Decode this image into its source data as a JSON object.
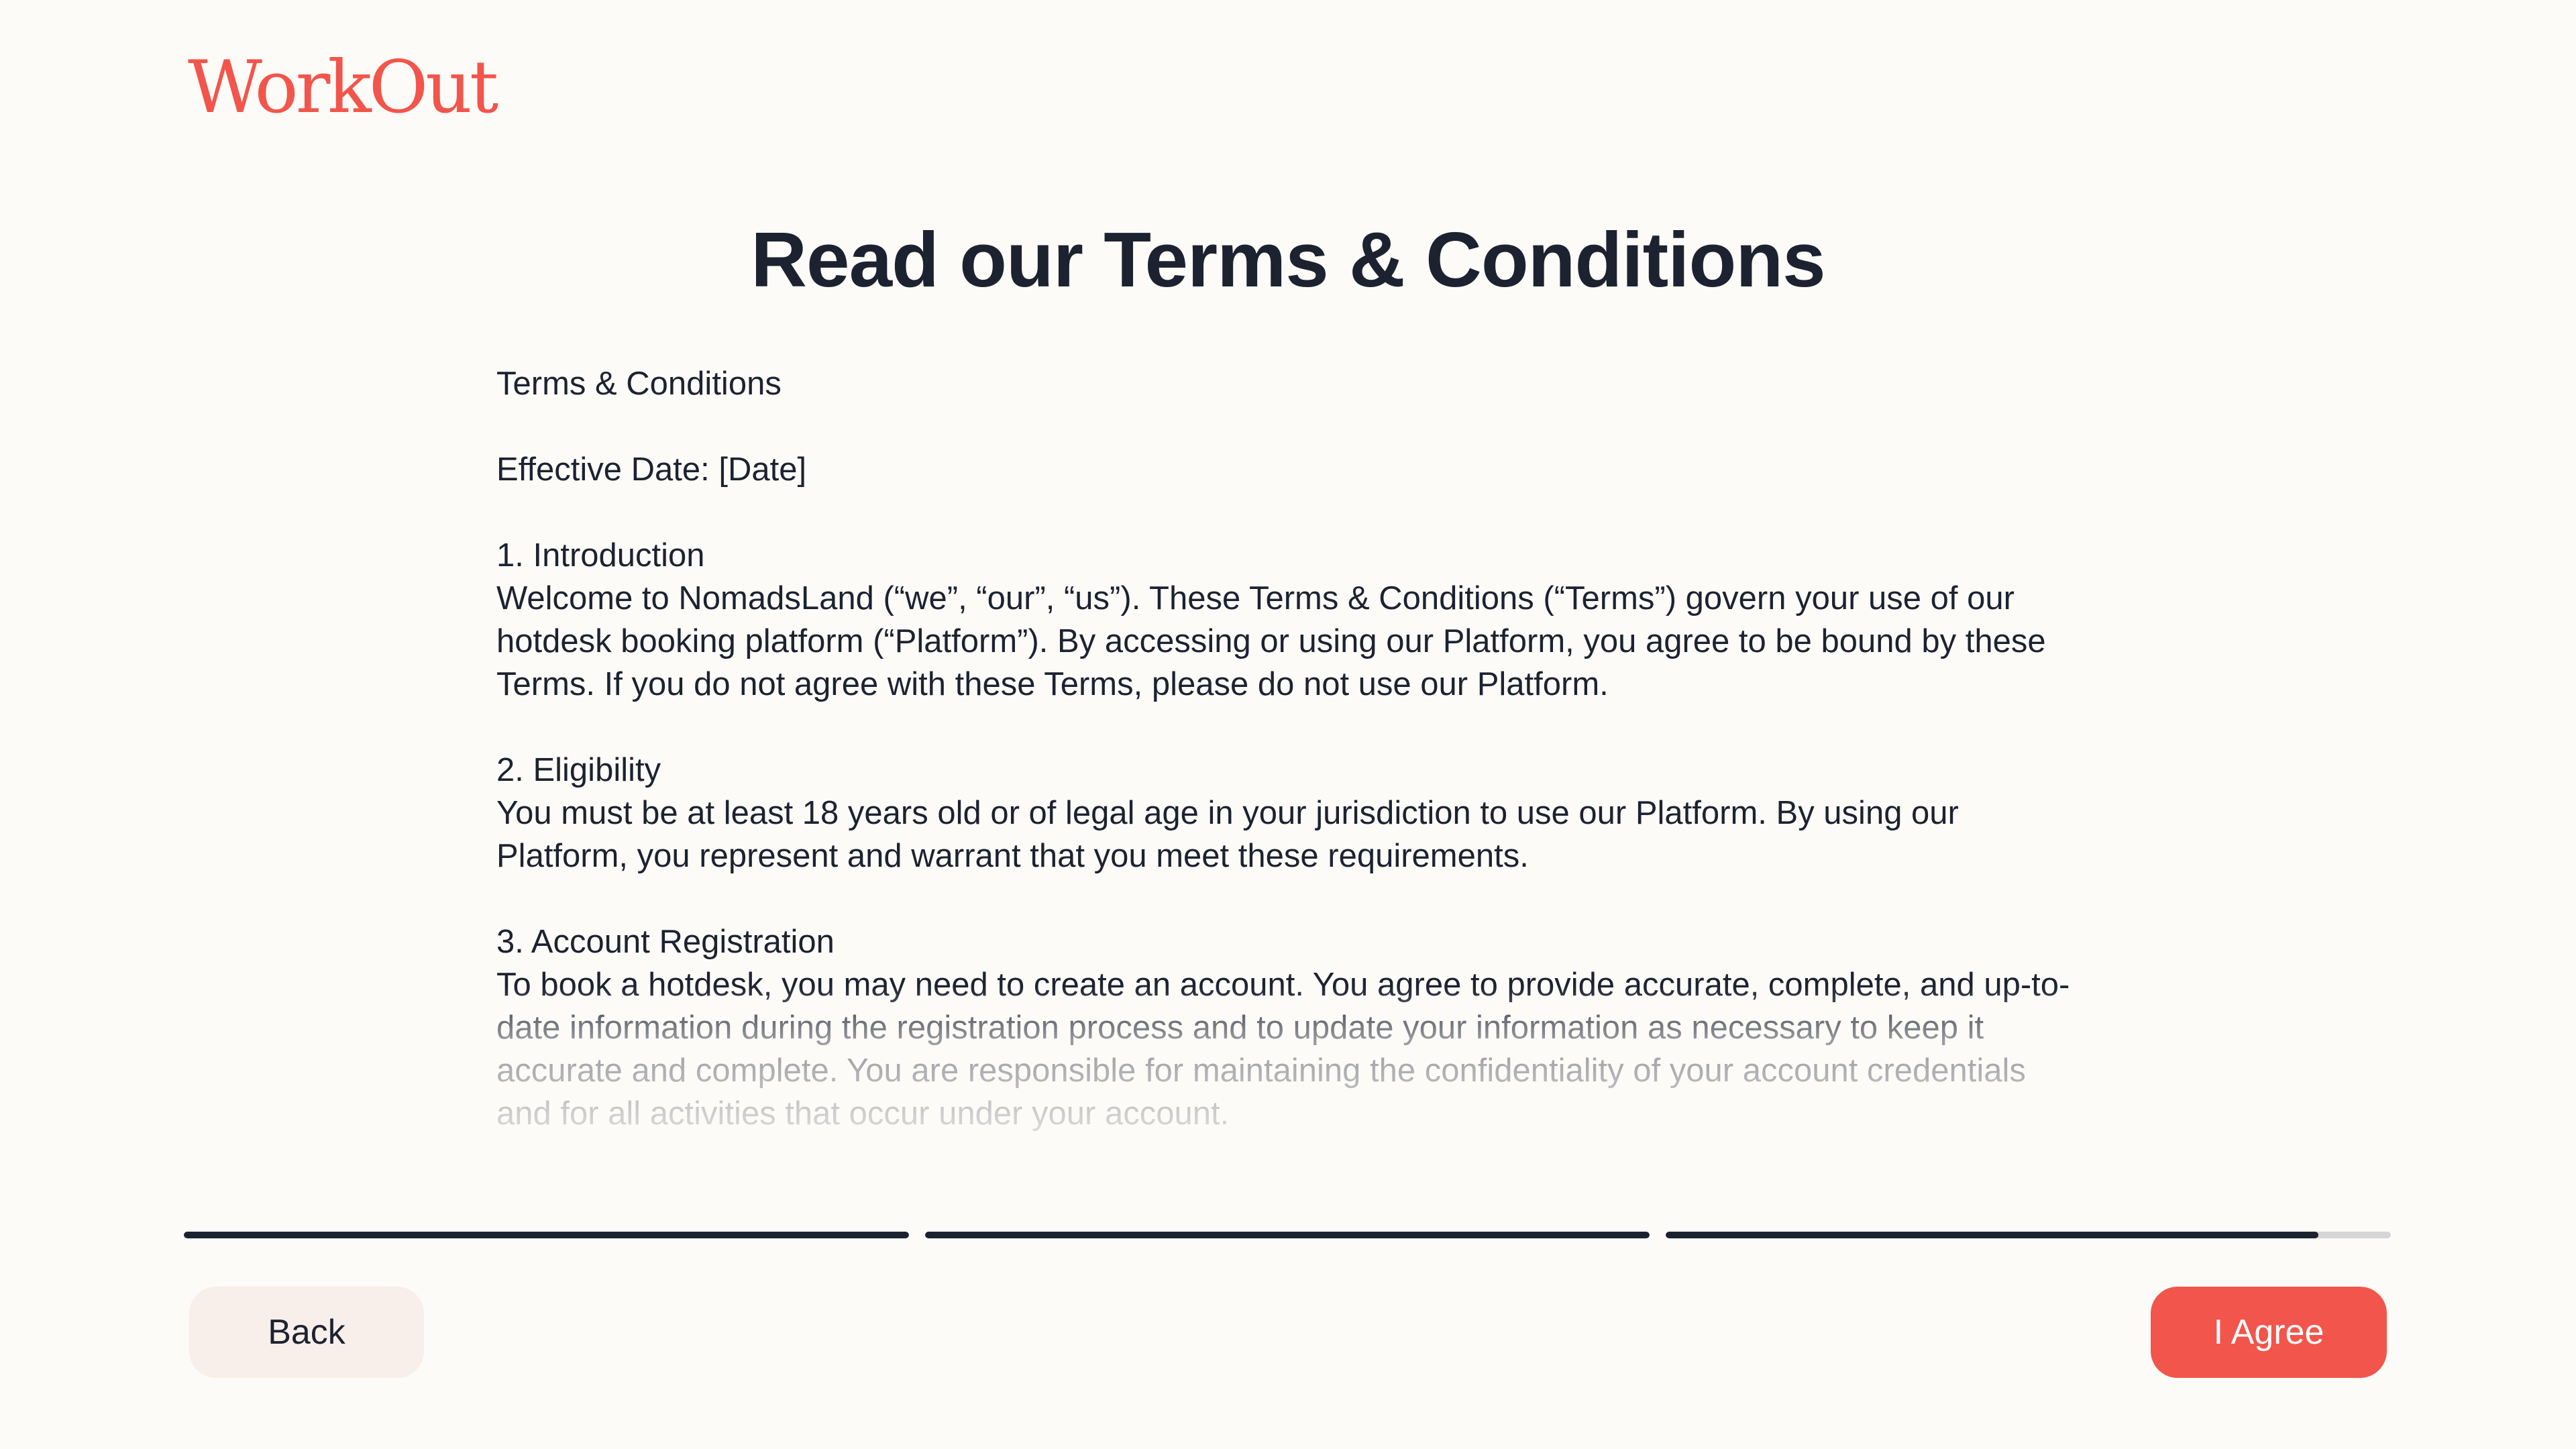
{
  "brand": {
    "name": "WorkOut",
    "color": "#f2554b"
  },
  "page": {
    "title": "Read our Terms & Conditions"
  },
  "terms": {
    "heading": "Terms & Conditions",
    "effective_date": "Effective Date: [Date]",
    "sections": [
      {
        "title": "1. Introduction",
        "body": "Welcome to NomadsLand (“we”, “our”, “us”). These Terms & Conditions (“Terms”) govern your use of our hotdesk booking platform (“Platform”). By accessing or using our Platform, you agree to be bound by these Terms. If you do not agree with these Terms, please do not use our Platform."
      },
      {
        "title": "2. Eligibility",
        "body": "You must be at least 18 years old or of legal age in your jurisdiction to use our Platform. By using our Platform, you represent and warrant that you meet these requirements."
      },
      {
        "title": "3. Account Registration",
        "body": "To book a hotdesk, you may need to create an account. You agree to provide accurate, complete, and up-to-date information during the registration process and to update your information as necessary to keep it accurate and complete. You are responsible for maintaining the confidentiality of your account credentials and for all activities that occur under your account."
      }
    ]
  },
  "progress": {
    "steps_total": 3,
    "step_fill": [
      1,
      1,
      0.9
    ],
    "fill_color": "#1c2230",
    "track_color": "#d6d6d6"
  },
  "actions": {
    "back_label": "Back",
    "agree_label": "I Agree"
  }
}
